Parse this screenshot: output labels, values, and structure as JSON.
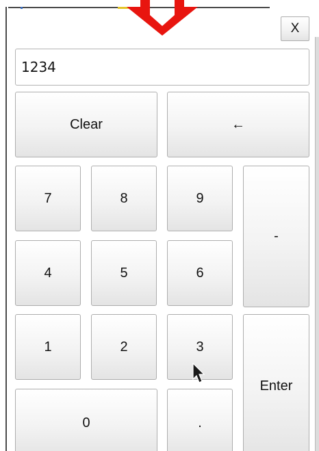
{
  "dialog": {
    "close_label": "X"
  },
  "display": {
    "value": "1234"
  },
  "keys": {
    "clear": "Clear",
    "backspace": "←",
    "seven": "7",
    "eight": "8",
    "nine": "9",
    "minus": "-",
    "four": "4",
    "five": "5",
    "six": "6",
    "one": "1",
    "two": "2",
    "three": "3",
    "enter": "Enter",
    "zero": "0",
    "decimal": "."
  },
  "colors": {
    "indicator_arrow": "#e8150f",
    "button_border": "#adadad"
  }
}
